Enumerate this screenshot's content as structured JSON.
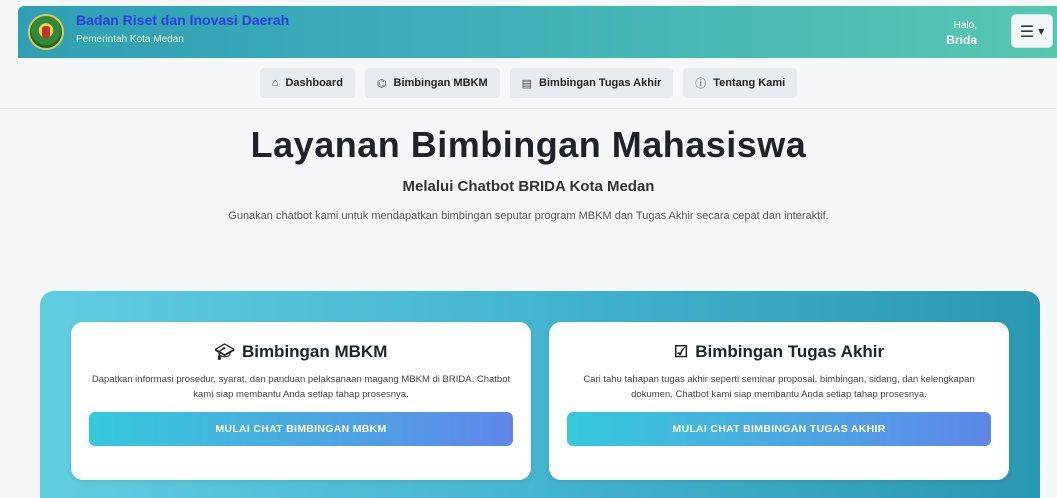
{
  "header": {
    "org_title": "Badan Riset dan Inovasi Daerah",
    "org_subtitle": "Pemerintah Kota Medan",
    "greeting": "Halo,",
    "user_name": "Brida",
    "menu_icon": "hamburger-icon"
  },
  "nav": {
    "items": [
      {
        "label": "Dashboard",
        "icon": "home-icon"
      },
      {
        "label": "Bimbingan MBKM",
        "icon": "graduation-cap-icon"
      },
      {
        "label": "Bimbingan Tugas Akhir",
        "icon": "document-icon"
      },
      {
        "label": "Tentang Kami",
        "icon": "info-icon"
      }
    ]
  },
  "hero": {
    "title": "Layanan Bimbingan Mahasiswa",
    "subtitle": "Melalui Chatbot BRIDA Kota Medan",
    "description": "Gunakan chatbot kami untuk mendapatkan bimbingan seputar program MBKM dan Tugas Akhir secara cepat dan interaktif."
  },
  "cards": [
    {
      "title": "Bimbingan MBKM",
      "icon": "graduation-cap-icon",
      "description": "Dapatkan informasi prosedur, syarat, dan panduan pelaksanaan magang MBKM di BRIDA. Chatbot kami siap membantu Anda setiap tahap prosesnya.",
      "button": "MULAI CHAT BIMBINGAN MBKM"
    },
    {
      "title": "Bimbingan Tugas Akhir",
      "icon": "checklist-icon",
      "description": "Cari tahu tahapan tugas akhir seperti seminar proposal, bimbingan, sidang, dan kelengkapan dokumen. Chatbot kami siap membantu Anda setiap tahap prosesnya.",
      "button": "MULAI CHAT BIMBINGAN TUGAS AKHIR"
    }
  ],
  "colors": {
    "header_gradient_start": "#2f9fb4",
    "header_gradient_end": "#58c7b0",
    "org_title": "#2b3de0",
    "button_gradient_start": "#35c9db",
    "button_gradient_end": "#5e86e8"
  }
}
